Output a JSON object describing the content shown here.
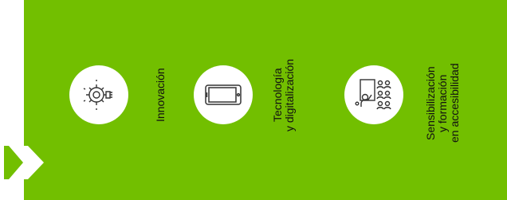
{
  "colors": {
    "panel_green": "#72bf00",
    "white": "#ffffff",
    "text": "#111111",
    "icon_stroke": "#333333",
    "arrow": "#72bf00"
  },
  "items": [
    {
      "label_lines": [
        "Innovación"
      ],
      "icon": "gear-lightbulb-icon"
    },
    {
      "label_lines": [
        "Tecnología",
        "y digitalización"
      ],
      "icon": "tablet-icon"
    },
    {
      "label_lines": [
        "Sensibilización",
        "y formación",
        "en accesibilidad"
      ],
      "icon": "training-audience-icon"
    }
  ],
  "decor": {
    "icon": "double-chevron-right-icon"
  }
}
